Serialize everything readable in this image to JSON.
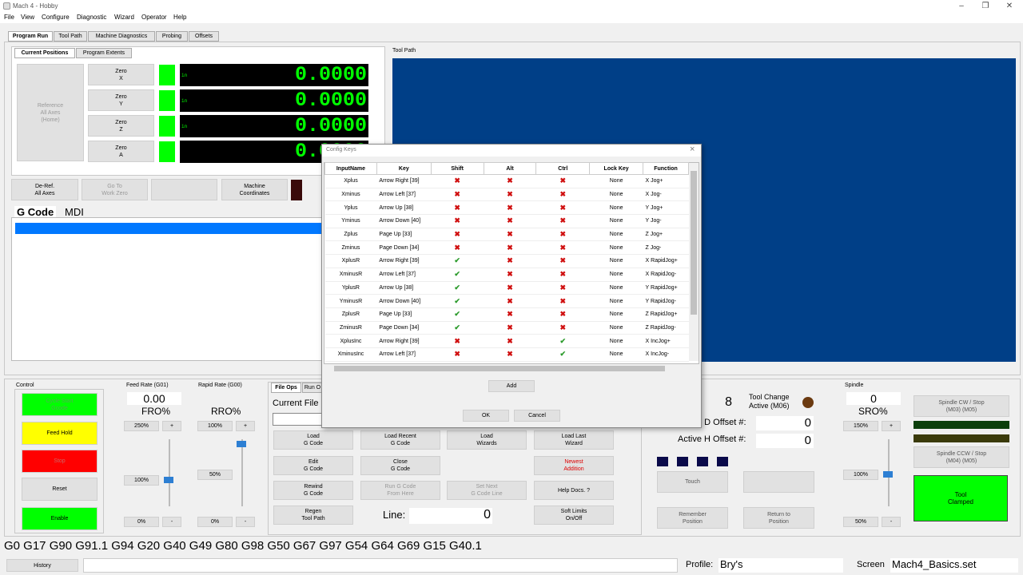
{
  "app": {
    "title": "Mach 4 - Hobby"
  },
  "menu": [
    "File",
    "View",
    "Configure",
    "Diagnostic",
    "Wizard",
    "Operator",
    "Help"
  ],
  "main_tabs": [
    "Program Run",
    "Tool Path",
    "Machine Diagnostics",
    "Probing",
    "Offsets"
  ],
  "positions": {
    "tabs": [
      "Current Positions",
      "Program Extents"
    ],
    "reference": "Reference\nAll Axes\n(Home)",
    "axes": [
      {
        "zero": "Zero\nX",
        "unit": "in",
        "value": "0.0000"
      },
      {
        "zero": "Zero\nY",
        "unit": "in",
        "value": "0.0000"
      },
      {
        "zero": "Zero\nZ",
        "unit": "in",
        "value": "0.0000"
      },
      {
        "zero": "Zero\nA",
        "unit": "",
        "value": "0.0000"
      }
    ],
    "deref": "De-Ref.\nAll Axes",
    "goto": "Go To\nWork Zero",
    "machine": "Machine\nCoordinates"
  },
  "toolpath_label": "Tool Path",
  "gcode_tabs": [
    "G Code",
    "MDI"
  ],
  "control": {
    "title": "Control",
    "cycle": "Cycle Start\nGcode",
    "feedhold": "Feed Hold",
    "stop": "Stop",
    "reset": "Reset",
    "enable": "Enable"
  },
  "feed": {
    "title": "Feed Rate (G01)",
    "value": "0.00",
    "label": "FRO%",
    "preset": "250%",
    "plus": "+",
    "mid": "100%",
    "low": "0%",
    "minus": "-"
  },
  "rapid": {
    "title": "Rapid Rate (G00)",
    "label": "RRO%",
    "preset": "100%",
    "plus": "+",
    "mid": "50%",
    "low": "0%",
    "minus": "-"
  },
  "fileops": {
    "tabs": [
      "File Ops",
      "Run O"
    ],
    "current": "Current File",
    "buttons": [
      "Load\nG Code",
      "Load Recent\nG Code",
      "Load\nWizards",
      "Load Last\nWizard",
      "Edit\nG Code",
      "Close\nG Code",
      "",
      "Newest\nAddition",
      "Rewind\nG Code",
      "Run G Code\nFrom Here",
      "Set Next\nG Code Line",
      "Help Docs. ?",
      "Regen\nTool Path",
      "",
      "",
      "Soft Limits\nOn/Off"
    ],
    "line_label": "Line:",
    "line_value": "0"
  },
  "tool": {
    "number": "8",
    "change": "Tool Change\nActive (M06)",
    "d_label": "e D Offset #:",
    "d_value": "0",
    "h_label": "Active H Offset #:",
    "h_value": "0",
    "touch": "Touch",
    "remember": "Remember\nPosition",
    "return": "Return to\nPosition"
  },
  "spindle": {
    "title": "Spindle",
    "value": "0",
    "label": "SRO%",
    "preset": "150%",
    "plus": "+",
    "mid": "100%",
    "low": "50%",
    "minus": "-",
    "cw": "Spindle CW / Stop\n(M03)          (M05)",
    "ccw": "Spindle CCW / Stop\n(M04)          (M05)",
    "tool": "Tool\nClamped"
  },
  "status": {
    "gcodes": "G0 G17 G90 G91.1 G94 G20 G40 G49 G80 G98 G50 G67 G97 G54 G64 G69 G15 G40.1",
    "history": "History",
    "profile_label": "Profile:",
    "profile": "Bry's",
    "screen_label": "Screen",
    "screen": "Mach4_Basics.set"
  },
  "dialog": {
    "title": "Config Keys",
    "close": "×",
    "columns": [
      "InputName",
      "Key",
      "Shift",
      "Alt",
      "Ctrl",
      "Lock Key",
      "Function"
    ],
    "rows": [
      {
        "name": "Xplus",
        "key": "Arrow Right [39]",
        "shift": "x",
        "alt": "x",
        "ctrl": "x",
        "lock": "None",
        "fn": "X Jog+"
      },
      {
        "name": "Xminus",
        "key": "Arrow Left [37]",
        "shift": "x",
        "alt": "x",
        "ctrl": "x",
        "lock": "None",
        "fn": "X Jog-"
      },
      {
        "name": "Yplus",
        "key": "Arrow Up [38]",
        "shift": "x",
        "alt": "x",
        "ctrl": "x",
        "lock": "None",
        "fn": "Y Jog+"
      },
      {
        "name": "Yminus",
        "key": "Arrow Down [40]",
        "shift": "x",
        "alt": "x",
        "ctrl": "x",
        "lock": "None",
        "fn": "Y Jog-"
      },
      {
        "name": "Zplus",
        "key": "Page Up [33]",
        "shift": "x",
        "alt": "x",
        "ctrl": "x",
        "lock": "None",
        "fn": "Z Jog+"
      },
      {
        "name": "Zminus",
        "key": "Page Down [34]",
        "shift": "x",
        "alt": "x",
        "ctrl": "x",
        "lock": "None",
        "fn": "Z Jog-"
      },
      {
        "name": "XplusR",
        "key": "Arrow Right [39]",
        "shift": "c",
        "alt": "x",
        "ctrl": "x",
        "lock": "None",
        "fn": "X RapidJog+"
      },
      {
        "name": "XminusR",
        "key": "Arrow Left [37]",
        "shift": "c",
        "alt": "x",
        "ctrl": "x",
        "lock": "None",
        "fn": "X RapidJog-"
      },
      {
        "name": "YplusR",
        "key": "Arrow Up [38]",
        "shift": "c",
        "alt": "x",
        "ctrl": "x",
        "lock": "None",
        "fn": "Y RapidJog+"
      },
      {
        "name": "YminusR",
        "key": "Arrow Down [40]",
        "shift": "c",
        "alt": "x",
        "ctrl": "x",
        "lock": "None",
        "fn": "Y RapidJog-"
      },
      {
        "name": "ZplusR",
        "key": "Page Up [33]",
        "shift": "c",
        "alt": "x",
        "ctrl": "x",
        "lock": "None",
        "fn": "Z RapidJog+"
      },
      {
        "name": "ZminusR",
        "key": "Page Down [34]",
        "shift": "c",
        "alt": "x",
        "ctrl": "x",
        "lock": "None",
        "fn": "Z RapidJog-"
      },
      {
        "name": "XplusInc",
        "key": "Arrow Right [39]",
        "shift": "x",
        "alt": "x",
        "ctrl": "c",
        "lock": "None",
        "fn": "X IncJog+"
      },
      {
        "name": "XminusInc",
        "key": "Arrow Left [37]",
        "shift": "x",
        "alt": "x",
        "ctrl": "c",
        "lock": "None",
        "fn": "X IncJog-"
      }
    ],
    "add": "Add",
    "ok": "OK",
    "cancel": "Cancel"
  },
  "colors": {
    "toolpath_bg": "#003f87",
    "dro_bg": "#000000",
    "dro_fg": "#00ff00",
    "cycle": "#00ff00",
    "feedhold": "#ffff00",
    "stop": "#ff0000"
  }
}
